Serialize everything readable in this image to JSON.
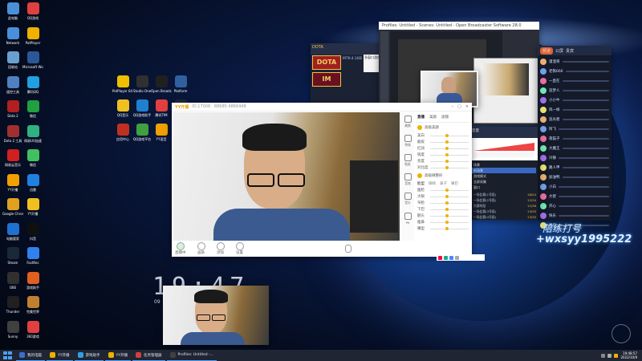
{
  "desktop": {
    "icons": [
      {
        "label": "此电脑",
        "color": "#4a90d9"
      },
      {
        "label": "QQ游戏",
        "color": "#e04040"
      },
      {
        "label": "Network",
        "color": "#4a90d9"
      },
      {
        "label": "PotPlayer",
        "color": "#f0b000"
      },
      {
        "label": "回收站",
        "color": "#6aa0d0"
      },
      {
        "label": "Microsoft Word 2010",
        "color": "#2b5797"
      },
      {
        "label": "遥控工具",
        "color": "#5080c0"
      },
      {
        "label": "腾讯QQ",
        "color": "#20a0e0"
      },
      {
        "label": "Dota 2",
        "color": "#b02020"
      },
      {
        "label": "微信",
        "color": "#20a040"
      },
      {
        "label": "Dota 2 工具",
        "color": "#a03030"
      },
      {
        "label": "网易UU加速",
        "color": "#30b080"
      },
      {
        "label": "网易云音乐",
        "color": "#d02020"
      },
      {
        "label": "微信",
        "color": "#40c060"
      },
      {
        "label": "YY开播",
        "color": "#f0a000"
      },
      {
        "label": "迅雷",
        "color": "#2080e0"
      },
      {
        "label": "Google Chrome",
        "color": "#e0a020"
      },
      {
        "label": "YY开播",
        "color": "#f0c020"
      },
      {
        "label": "电脑管家",
        "color": "#2070d0"
      },
      {
        "label": "抖音",
        "color": "#101010"
      },
      {
        "label": "Steam",
        "color": "#1b2838"
      },
      {
        "label": "FastRec",
        "color": "#3080f0"
      },
      {
        "label": "OBS",
        "color": "#303030"
      },
      {
        "label": "游戏助手",
        "color": "#e06020"
      },
      {
        "label": "Thunder",
        "color": "#202020"
      },
      {
        "label": "完美世界",
        "color": "#c08030"
      },
      {
        "label": "Sunny",
        "color": "#404040"
      },
      {
        "label": "360游戏",
        "color": "#e04040"
      }
    ],
    "icons2": [
      {
        "label": "PotPlayer 64 bit",
        "color": "#f0c000"
      },
      {
        "label": "Studio One",
        "color": "#303030"
      },
      {
        "label": "Open Broadcaster",
        "color": "#202020"
      },
      {
        "label": "Platform",
        "color": "#3060a0"
      },
      {
        "label": "QQ音乐",
        "color": "#f0c020"
      },
      {
        "label": "QQ游戏助手",
        "color": "#2080d0"
      },
      {
        "label": "腾讯TIM",
        "color": "#e04040"
      },
      {
        "label": "Steam",
        "color": "#1b2838"
      },
      {
        "label": "应用中心",
        "color": "#c03020"
      },
      {
        "label": "QQ游戏平台",
        "color": "#40a040"
      },
      {
        "label": "YY语音",
        "color": "#f0a000"
      },
      {
        "label": "一键换肤",
        "color": "#c04080"
      }
    ],
    "clock": "19:47",
    "date": "09"
  },
  "yy_window": {
    "title": "YY开播",
    "room_info": "ID:17008 · 88685 4866448",
    "tabs": [
      "直播",
      "美颜",
      "滤镜"
    ],
    "side_items": [
      "美颜",
      "特效",
      "贴纸",
      "音效",
      "音乐",
      "PK"
    ],
    "sliders_top": [
      "美白",
      "磨皮",
      "红润",
      "锐度",
      "亮度",
      "对比度"
    ],
    "section_label": "高级美颜",
    "section2_label": "高级微整形",
    "tabs2": [
      "脸型",
      "眼睛",
      "鼻子",
      "嘴巴"
    ],
    "sliders_bottom": [
      "瘦脸",
      "大眼",
      "窄脸",
      "下巴",
      "额头",
      "瘦鼻",
      "嘴型"
    ],
    "bottom_buttons": [
      "直播中",
      "画质",
      "添加",
      "设置"
    ]
  },
  "obs_window": {
    "title": "Profiles: Untitled - Scenes: Untitled - Open Broadcaster Software 28.0"
  },
  "dota_panel": {
    "items": [
      "DOTA",
      "IM"
    ],
    "caption": "MTK-4.1KB",
    "popup": "多窗口游戏"
  },
  "mixer": {
    "rows": [
      "音量",
      "麦克风",
      "系统声",
      "伴奏"
    ],
    "scenes": [
      "场景",
      "新场景",
      "游戏模式",
      "全屏采集",
      "窗口"
    ],
    "list": [
      "一场比赛(1号段)",
      "一场比赛(2号段)",
      "大赛时段",
      "一场比赛(3号段)",
      "一场比赛(4号段)"
    ],
    "list_values": [
      "18/24",
      "12/34",
      "12/36",
      "13/35",
      "13/30"
    ]
  },
  "chat_panel": {
    "title": "频道",
    "tabs": [
      "公屏",
      "贵宾"
    ],
    "users": [
      "潇洒哥",
      "老铁666",
      "一直在",
      "追梦人",
      "小小牛",
      "风一样",
      "追光者",
      "阿飞",
      "夜猫子",
      "大魔王",
      "冷静",
      "路人甲",
      "加油鸭",
      "小白",
      "大佬",
      "开心",
      "快乐",
      "星辰"
    ]
  },
  "watermark": {
    "line1": "陪练打号",
    "line2": "+wxsyy1995222"
  },
  "taskbar": {
    "items": [
      "我的电脑",
      "YY开播",
      "游戏助手",
      "YY开播",
      "任务管理器",
      "Profiles: Untitled -..."
    ],
    "time": "19:48:57",
    "date": "2022/10/9"
  },
  "colors": {
    "accent": "#4aa0ff",
    "taskbar": "#1f2533",
    "brand_yy": "#f0b000"
  }
}
